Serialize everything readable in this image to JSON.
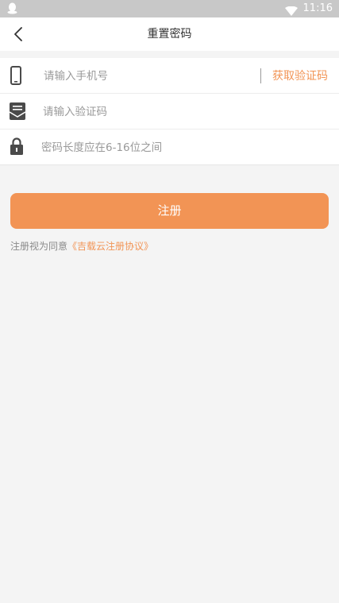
{
  "status_bar": {
    "time": "11:16",
    "app_icon": "qq-penguin-icon",
    "wifi_icon": "wifi-icon"
  },
  "toolbar": {
    "title": "重置密码",
    "back_icon": "back-chevron-icon"
  },
  "form": {
    "phone": {
      "placeholder": "请输入手机号",
      "icon": "phone-icon"
    },
    "sms_button_label": "获取验证码",
    "code": {
      "placeholder": "请输入验证码",
      "icon": "envelope-icon"
    },
    "password": {
      "placeholder": "密码长度应在6-16位之间",
      "icon": "lock-icon"
    }
  },
  "submit_label": "注册",
  "agreement": {
    "prefix": "注册视为同意",
    "link": "《吉载云注册协议》"
  },
  "colors": {
    "accent": "#f29455",
    "background": "#f4f4f4",
    "status_bar": "#c8c8c8"
  }
}
